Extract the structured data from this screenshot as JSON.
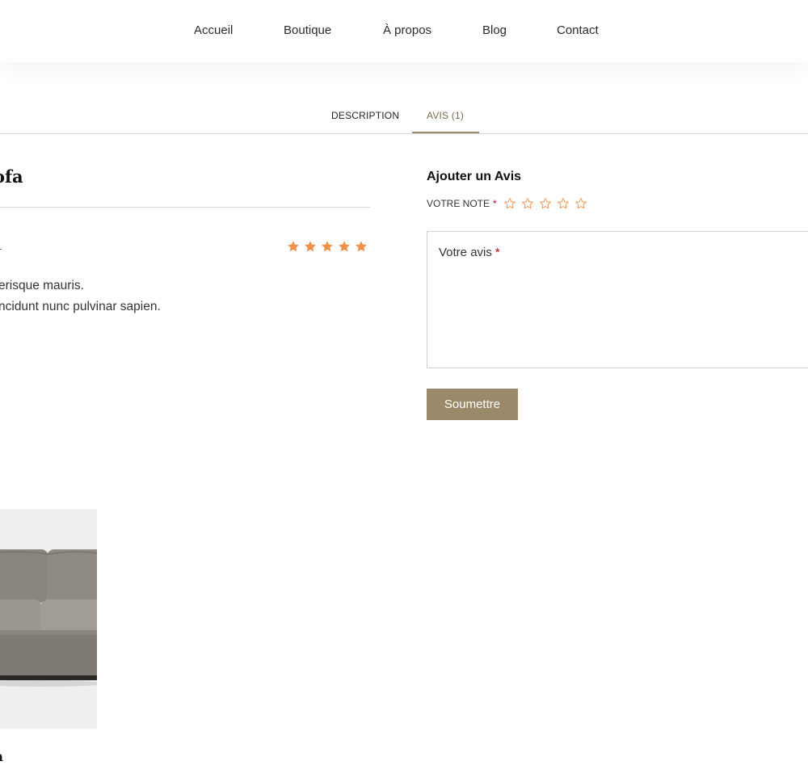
{
  "nav": {
    "items": [
      {
        "label": "Accueil"
      },
      {
        "label": "Boutique"
      },
      {
        "label": "À propos"
      },
      {
        "label": "Blog"
      },
      {
        "label": "Contact"
      }
    ]
  },
  "tabs": [
    {
      "label": "DESCRIPTION",
      "active": false
    },
    {
      "label": "AVIS (1)",
      "active": true
    }
  ],
  "review": {
    "title_visible": "ofa",
    "meta_visible": "1",
    "rating": 5,
    "rating_max": 5,
    "lines": [
      "erisque mauris.",
      "ncidunt nunc pulvinar sapien."
    ]
  },
  "review_form": {
    "title": "Ajouter un Avis",
    "rating_label": "VOTRE NOTE",
    "required_mark": "*",
    "textarea_label": "Votre avis",
    "submit_label": "Soumettre"
  },
  "product": {
    "name_visible": "a"
  },
  "colors": {
    "accent": "#9b8a6a",
    "star": "#f0904a",
    "required": "#c0021d"
  },
  "icons": {
    "star_filled": "star-icon",
    "star_empty": "star-outline-icon"
  }
}
